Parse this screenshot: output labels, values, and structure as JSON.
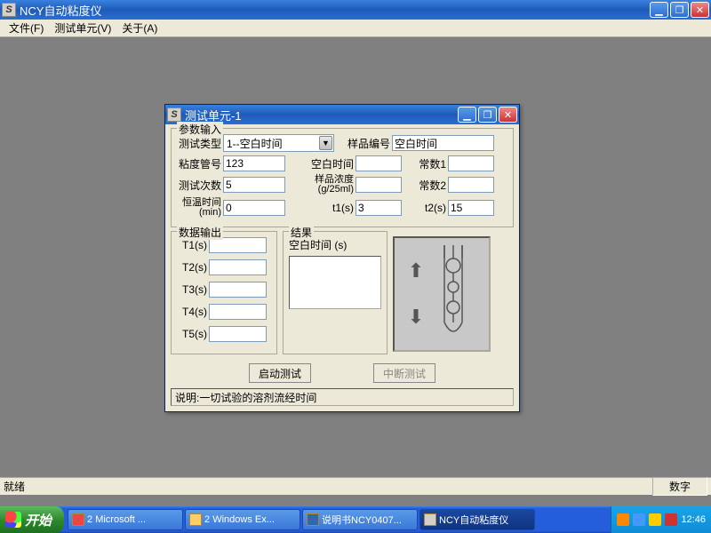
{
  "main": {
    "title": "NCY自动粘度仪",
    "menus": {
      "file": "文件(F)",
      "unit": "测试单元(V)",
      "about": "关于(A)"
    },
    "status": {
      "ready": "就绪",
      "num": "数字"
    }
  },
  "dialog": {
    "title": "测试单元-1",
    "group_params": "参数输入",
    "labels": {
      "test_type": "测试类型",
      "sample_no": "样品编号",
      "tube_no": "粘度管号",
      "blank_time": "空白时间",
      "const1": "常数1",
      "test_count": "测试次数",
      "sample_conc": "样品浓度(g/25ml)",
      "const2": "常数2",
      "temp_time": "恒温时间(min)",
      "t1s": "t1(s)",
      "t2s": "t2(s)"
    },
    "values": {
      "test_type": "1--空白时间",
      "sample_no": "空白时间",
      "tube_no": "123",
      "blank_time": "",
      "const1": "",
      "test_count": "5",
      "sample_conc": "",
      "const2": "",
      "temp_time": "0",
      "t1s": "3",
      "t2s": "15"
    },
    "group_data": "数据输出",
    "t_labels": [
      "T1(s)",
      "T2(s)",
      "T3(s)",
      "T4(s)",
      "T5(s)"
    ],
    "group_result": "结果",
    "result_label": "空白时间 (s)",
    "btn_start": "启动测试",
    "btn_stop": "中断测试",
    "explain_label": "说明:",
    "explain_text": "一切试验的溶剂流经时间"
  },
  "taskbar": {
    "start": "开始",
    "tasks": [
      "2 Microsoft ...",
      "2 Windows Ex...",
      "说明书NCY0407...",
      "NCY自动粘度仪"
    ],
    "time": "12:46"
  }
}
